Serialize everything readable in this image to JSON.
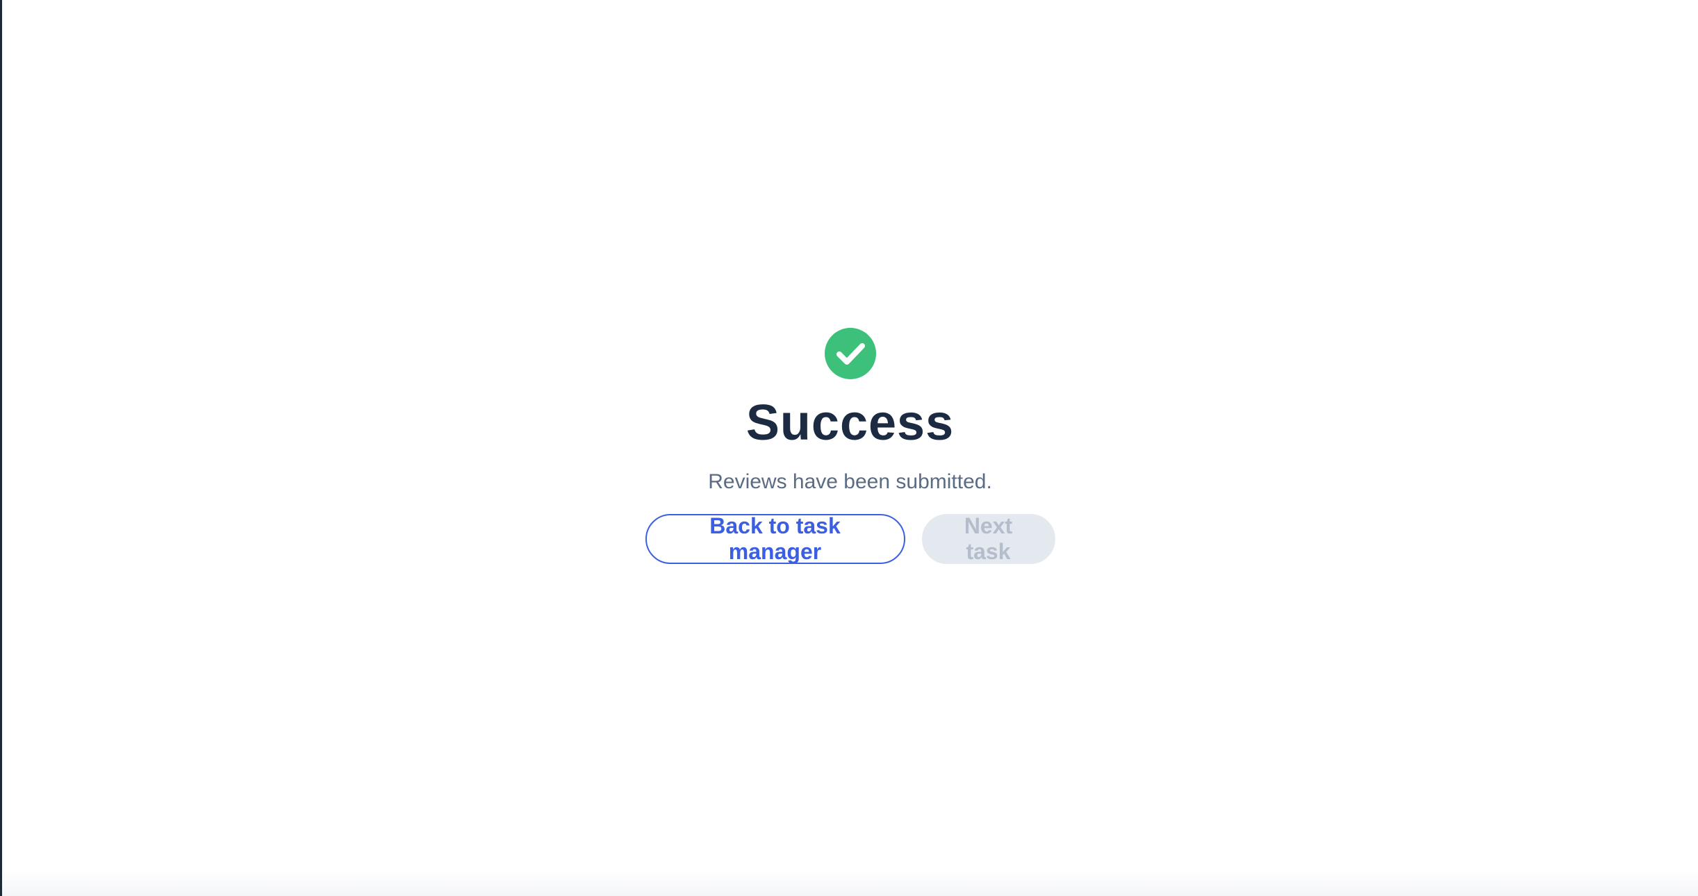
{
  "status": {
    "icon": "check-circle-icon",
    "title": "Success",
    "message": "Reviews have been submitted."
  },
  "actions": {
    "back_label": "Back to task manager",
    "next_label": "Next task"
  },
  "colors": {
    "success": "#3cc07a",
    "accent": "#3b5fe0",
    "title": "#1c2b42",
    "muted": "#5a6b82",
    "disabled_bg": "#e4e8ef",
    "disabled_text": "#b4bdcb"
  }
}
